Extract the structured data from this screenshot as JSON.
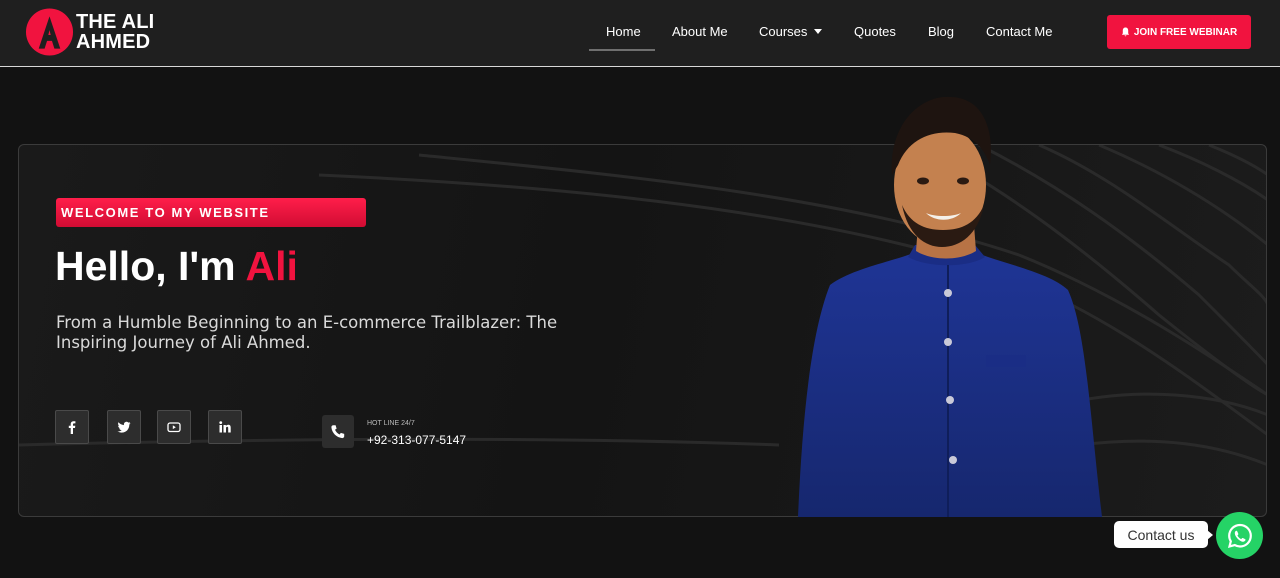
{
  "brand": {
    "line1": "THE ALI",
    "line2": "AHMED",
    "accent_color": "#f1133f"
  },
  "nav": {
    "items": [
      {
        "label": "Home",
        "active": true
      },
      {
        "label": "About Me"
      },
      {
        "label": "Courses"
      },
      {
        "label": "Quotes"
      },
      {
        "label": "Blog"
      },
      {
        "label": "Contact Me"
      }
    ],
    "cta_label": "JOIN FREE WEBINAR",
    "cta_icon": "bell-icon"
  },
  "hero": {
    "badge": "WELCOME TO MY WEBSITE",
    "title_prefix": "Hello, I'm ",
    "title_name": "Ali",
    "subtitle": "From a Humble Beginning to an E-commerce Trailblazer: The Inspiring Journey of Ali Ahmed.",
    "social": [
      "facebook-icon",
      "twitter-icon",
      "youtube-icon",
      "linkedin-icon"
    ],
    "hotline_label": "HOT LINE 24/7",
    "hotline_number": "+92-313-077-5147"
  },
  "contact_widget": {
    "label": "Contact us",
    "icon": "whatsapp-icon",
    "color": "#25d366"
  }
}
